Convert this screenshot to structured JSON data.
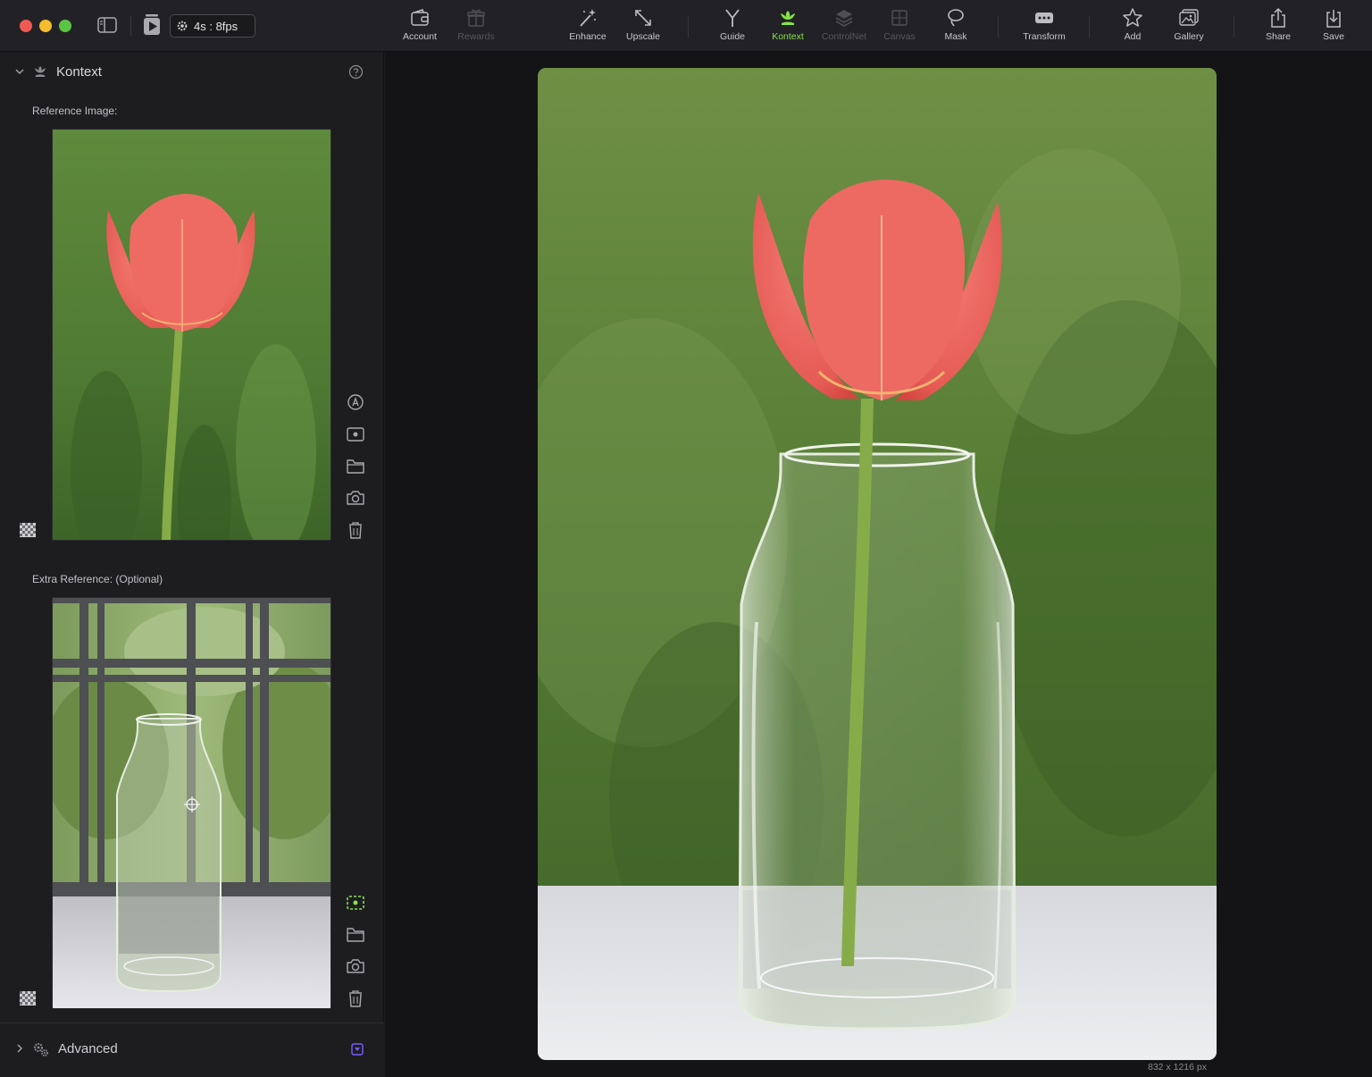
{
  "toolbar": {
    "fps_label": "4s : 8fps",
    "tools": [
      {
        "id": "account",
        "label": "Account",
        "state": "normal"
      },
      {
        "id": "rewards",
        "label": "Rewards",
        "state": "disabled"
      },
      {
        "id": "enhance",
        "label": "Enhance",
        "state": "normal"
      },
      {
        "id": "upscale",
        "label": "Upscale",
        "state": "normal"
      },
      {
        "id": "guide",
        "label": "Guide",
        "state": "normal"
      },
      {
        "id": "kontext",
        "label": "Kontext",
        "state": "active"
      },
      {
        "id": "controlnet",
        "label": "ControlNet",
        "state": "disabled"
      },
      {
        "id": "canvas",
        "label": "Canvas",
        "state": "disabled"
      },
      {
        "id": "mask",
        "label": "Mask",
        "state": "normal"
      },
      {
        "id": "transform",
        "label": "Transform",
        "state": "normal"
      },
      {
        "id": "add",
        "label": "Add",
        "state": "normal"
      },
      {
        "id": "gallery",
        "label": "Gallery",
        "state": "normal"
      },
      {
        "id": "share",
        "label": "Share",
        "state": "normal"
      },
      {
        "id": "save",
        "label": "Save",
        "state": "normal"
      }
    ]
  },
  "panel": {
    "section_title": "Kontext",
    "reference_label": "Reference Image:",
    "extra_reference_label": "Extra Reference: (Optional)",
    "advanced_title": "Advanced"
  },
  "canvas": {
    "dimensions": "832 x 1216 px"
  },
  "colors": {
    "accent_green": "#86e34a",
    "accent_purple": "#7a5cff",
    "background": "#141416"
  }
}
